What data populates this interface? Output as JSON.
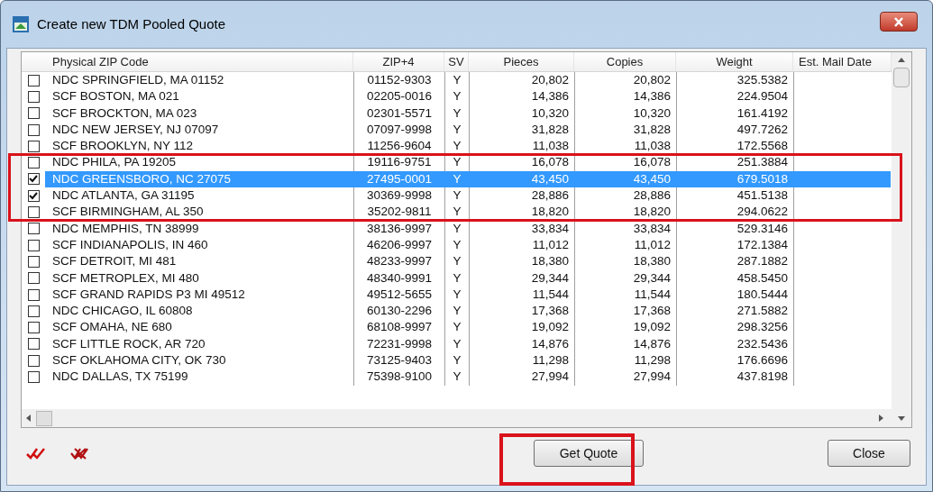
{
  "window": {
    "title": "Create new TDM Pooled Quote"
  },
  "table": {
    "columns": [
      "Physical ZIP Code",
      "ZIP+4",
      "SV",
      "Pieces",
      "Copies",
      "Weight",
      "Est. Mail Date"
    ],
    "rows": [
      {
        "checked": false,
        "selected": false,
        "cells": [
          "NDC SPRINGFIELD, MA  01152",
          "01152-9303",
          "Y",
          "20,802",
          "20,802",
          "325.5382"
        ]
      },
      {
        "checked": false,
        "selected": false,
        "cells": [
          "SCF BOSTON, MA  021",
          "02205-0016",
          "Y",
          "14,386",
          "14,386",
          "224.9504"
        ]
      },
      {
        "checked": false,
        "selected": false,
        "cells": [
          "SCF BROCKTON, MA  023",
          "02301-5571",
          "Y",
          "10,320",
          "10,320",
          "161.4192"
        ]
      },
      {
        "checked": false,
        "selected": false,
        "cells": [
          "NDC NEW JERSEY, NJ  07097",
          "07097-9998",
          "Y",
          "31,828",
          "31,828",
          "497.7262"
        ]
      },
      {
        "checked": false,
        "selected": false,
        "cells": [
          "SCF BROOKLYN, NY  112",
          "11256-9604",
          "Y",
          "11,038",
          "11,038",
          "172.5568"
        ]
      },
      {
        "checked": false,
        "selected": false,
        "cells": [
          "NDC PHILA, PA  19205",
          "19116-9751",
          "Y",
          "16,078",
          "16,078",
          "251.3884"
        ]
      },
      {
        "checked": true,
        "selected": true,
        "cells": [
          "NDC GREENSBORO, NC  27075",
          "27495-0001",
          "Y",
          "43,450",
          "43,450",
          "679.5018"
        ]
      },
      {
        "checked": true,
        "selected": false,
        "cells": [
          "NDC ATLANTA, GA  31195",
          "30369-9998",
          "Y",
          "28,886",
          "28,886",
          "451.5138"
        ]
      },
      {
        "checked": false,
        "selected": false,
        "cells": [
          "SCF BIRMINGHAM, AL  350",
          "35202-9811",
          "Y",
          "18,820",
          "18,820",
          "294.0622"
        ]
      },
      {
        "checked": false,
        "selected": false,
        "cells": [
          "NDC MEMPHIS, TN  38999",
          "38136-9997",
          "Y",
          "33,834",
          "33,834",
          "529.3146"
        ]
      },
      {
        "checked": false,
        "selected": false,
        "cells": [
          "SCF INDIANAPOLIS, IN  460",
          "46206-9997",
          "Y",
          "11,012",
          "11,012",
          "172.1384"
        ]
      },
      {
        "checked": false,
        "selected": false,
        "cells": [
          "SCF DETROIT, MI  481",
          "48233-9997",
          "Y",
          "18,380",
          "18,380",
          "287.1882"
        ]
      },
      {
        "checked": false,
        "selected": false,
        "cells": [
          "SCF METROPLEX, MI  480",
          "48340-9991",
          "Y",
          "29,344",
          "29,344",
          "458.5450"
        ]
      },
      {
        "checked": false,
        "selected": false,
        "cells": [
          "SCF GRAND RAPIDS P3 MI 49512",
          "49512-5655",
          "Y",
          "11,544",
          "11,544",
          "180.5444"
        ]
      },
      {
        "checked": false,
        "selected": false,
        "cells": [
          "NDC CHICAGO, IL  60808",
          "60130-2296",
          "Y",
          "17,368",
          "17,368",
          "271.5882"
        ]
      },
      {
        "checked": false,
        "selected": false,
        "cells": [
          "SCF OMAHA, NE  680",
          "68108-9997",
          "Y",
          "19,092",
          "19,092",
          "298.3256"
        ]
      },
      {
        "checked": false,
        "selected": false,
        "cells": [
          "SCF LITTLE ROCK, AR  720",
          "72231-9998",
          "Y",
          "14,876",
          "14,876",
          "232.5436"
        ]
      },
      {
        "checked": false,
        "selected": false,
        "cells": [
          "SCF OKLAHOMA CITY, OK  730",
          "73125-9403",
          "Y",
          "11,298",
          "11,298",
          "176.6696"
        ]
      },
      {
        "checked": false,
        "selected": false,
        "cells": [
          "NDC DALLAS, TX  75199",
          "75398-9100",
          "Y",
          "27,994",
          "27,994",
          "437.8198"
        ]
      }
    ]
  },
  "buttons": [
    {
      "kind": "quote",
      "label": "Get Quote"
    },
    {
      "kind": "close",
      "label": "Close"
    }
  ]
}
